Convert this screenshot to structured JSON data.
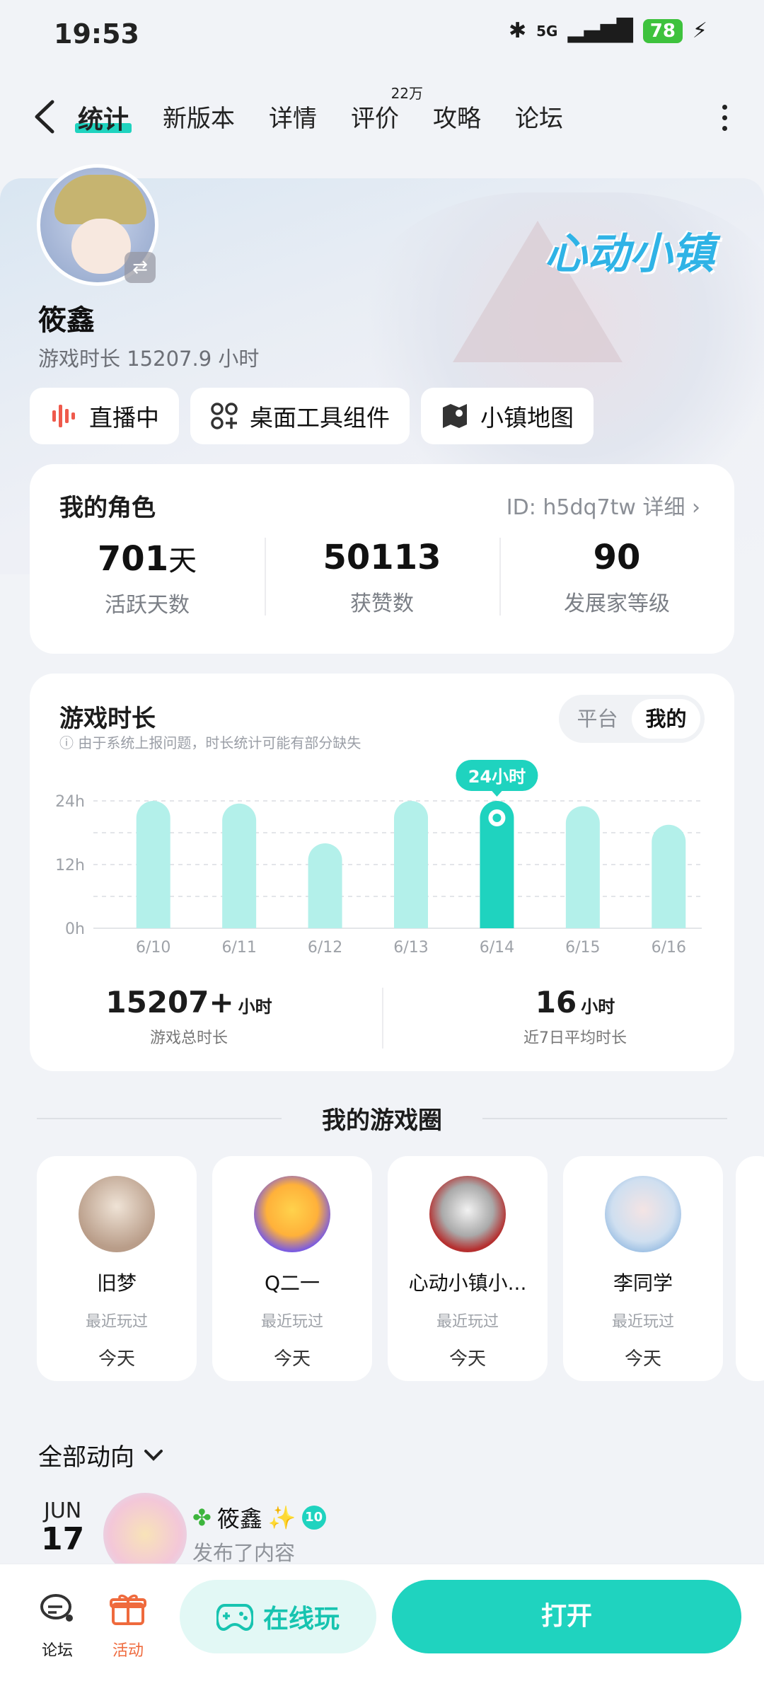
{
  "status_bar": {
    "time": "19:53",
    "network": "5G",
    "battery": "78"
  },
  "header": {
    "tabs": [
      {
        "label": "统计",
        "active": true
      },
      {
        "label": "新版本"
      },
      {
        "label": "详情"
      },
      {
        "label": "评价",
        "badge": "22万"
      },
      {
        "label": "攻略"
      },
      {
        "label": "论坛"
      }
    ]
  },
  "profile": {
    "name": "筱鑫",
    "play_time": "游戏时长 15207.9 小时",
    "game_logo": "心动小镇",
    "chips": [
      {
        "label": "直播中",
        "icon": "live-icon"
      },
      {
        "label": "桌面工具组件",
        "icon": "widgets-icon"
      },
      {
        "label": "小镇地图",
        "icon": "map-icon"
      }
    ]
  },
  "role_card": {
    "title": "我的角色",
    "id_text": "ID: h5dq7tw 详细",
    "stats": [
      {
        "value": "701",
        "unit": "天",
        "label": "活跃天数"
      },
      {
        "value": "50113",
        "unit": "",
        "label": "获赞数"
      },
      {
        "value": "90",
        "unit": "",
        "label": "发展家等级"
      }
    ]
  },
  "time_card": {
    "title": "游戏时长",
    "note": "由于系统上报问题，时长统计可能有部分缺失",
    "toggle": {
      "option_a": "平台",
      "option_b": "我的",
      "selected": "我的"
    },
    "tooltip": "24小时",
    "total": {
      "value": "15207+",
      "unit": "小时",
      "label": "游戏总时长"
    },
    "average": {
      "value": "16",
      "unit": "小时",
      "label": "近7日平均时长"
    }
  },
  "chart_data": {
    "type": "bar",
    "categories": [
      "6/10",
      "6/11",
      "6/12",
      "6/13",
      "6/14",
      "6/15",
      "6/16"
    ],
    "values": [
      24,
      23.5,
      16,
      24,
      24,
      23,
      19.5
    ],
    "highlight_index": 4,
    "y_ticks": [
      "0h",
      "12h",
      "24h"
    ],
    "ylim": [
      0,
      24
    ],
    "colors": {
      "bar": "#b3f0ea",
      "highlight": "#1fd3bf"
    },
    "grid": true
  },
  "game_circle": {
    "title": "我的游戏圈",
    "friends": [
      {
        "name": "旧梦",
        "recent": "最近玩过",
        "when": "今天",
        "color": "#d8c7bb"
      },
      {
        "name": "Q二一",
        "recent": "最近玩过",
        "when": "今天",
        "color": "#8e6fe0"
      },
      {
        "name": "心动小镇小...",
        "recent": "最近玩过",
        "when": "今天",
        "color": "#c43a3a"
      },
      {
        "name": "李同学",
        "recent": "最近玩过",
        "when": "今天",
        "color": "#cfdff0"
      }
    ]
  },
  "feed": {
    "filter_label": "全部动向",
    "items": [
      {
        "month": "JUN",
        "day": "17",
        "name": "筱鑫",
        "level": "10",
        "action": "发布了内容"
      }
    ]
  },
  "bottom_bar": {
    "forum_label": "论坛",
    "activity_label": "活动",
    "online_play": "在线玩",
    "open": "打开"
  }
}
